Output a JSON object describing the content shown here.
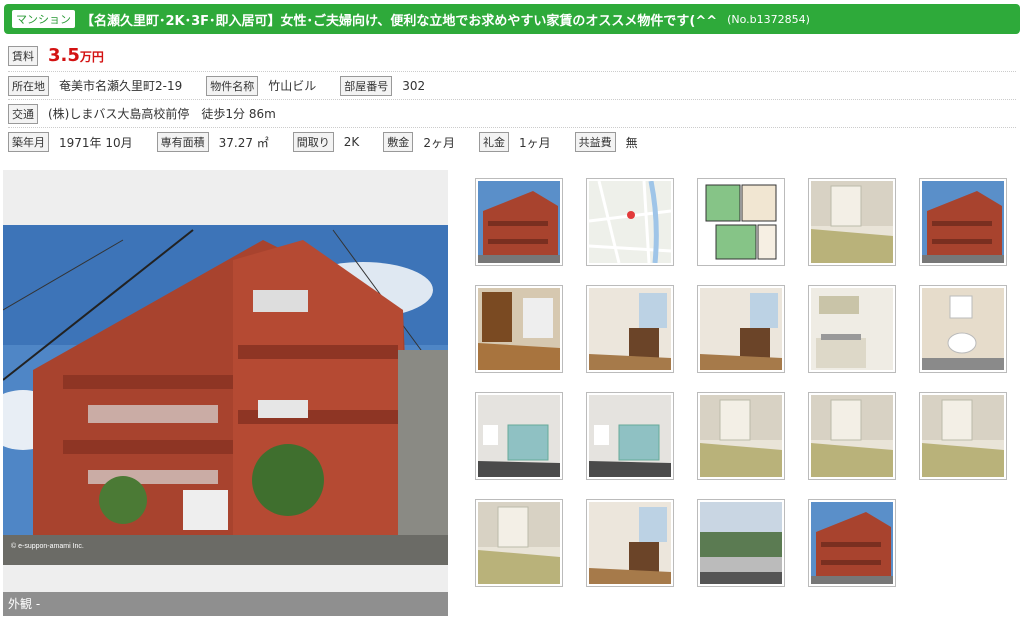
{
  "header": {
    "type_badge": "マンション",
    "title": "【名瀬久里町･2K･3F･即入居可】女性･ご夫婦向け、便利な立地でお求めやすい家賃のオススメ物件です(^^",
    "listing_no": "(No.b1372854)"
  },
  "rent": {
    "label": "賃料",
    "amount": "3.5",
    "unit": "万円"
  },
  "details": {
    "location_label": "所在地",
    "location": "奄美市名瀬久里町2-19",
    "building_label": "物件名称",
    "building": "竹山ビル",
    "room_label": "部屋番号",
    "room": "302",
    "access_label": "交通",
    "access": "(株)しまバス大島高校前停　徒歩1分 86m",
    "built_label": "築年月",
    "built": "1971年 10月",
    "area_label": "専有面積",
    "area": "37.27 ㎡",
    "layout_label": "間取り",
    "layout": "2K",
    "deposit_label": "敷金",
    "deposit": "2ヶ月",
    "keymoney_label": "礼金",
    "keymoney": "1ヶ月",
    "commonfee_label": "共益費",
    "commonfee": "無"
  },
  "main_photo": {
    "caption": "外観 -",
    "watermark": "© e-suppon-amami Inc."
  },
  "thumbnails": [
    {
      "name": "exterior-1",
      "kind": "exterior"
    },
    {
      "name": "map",
      "kind": "map"
    },
    {
      "name": "floorplan",
      "kind": "floorplan"
    },
    {
      "name": "tatami-room-1",
      "kind": "tatami"
    },
    {
      "name": "exterior-2",
      "kind": "exterior"
    },
    {
      "name": "entrance",
      "kind": "wood"
    },
    {
      "name": "closet",
      "kind": "room"
    },
    {
      "name": "hallway",
      "kind": "room"
    },
    {
      "name": "kitchen",
      "kind": "kitchen"
    },
    {
      "name": "toilet",
      "kind": "toilet"
    },
    {
      "name": "bathroom-1",
      "kind": "bath"
    },
    {
      "name": "bathtub",
      "kind": "bath"
    },
    {
      "name": "tatami-room-2",
      "kind": "tatami"
    },
    {
      "name": "sliding-door",
      "kind": "tatami"
    },
    {
      "name": "tatami-room-3",
      "kind": "tatami"
    },
    {
      "name": "window-room",
      "kind": "tatami"
    },
    {
      "name": "curtain-window",
      "kind": "room"
    },
    {
      "name": "view",
      "kind": "view"
    },
    {
      "name": "balcony",
      "kind": "exterior"
    }
  ],
  "colors": {
    "header_green": "#2eaa3a",
    "rent_red": "#d31212"
  }
}
